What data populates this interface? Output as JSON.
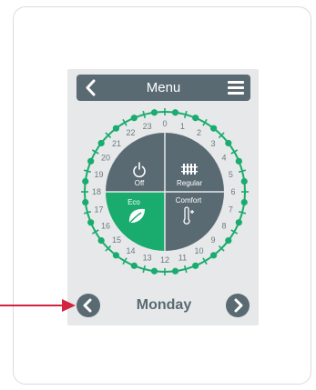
{
  "colors": {
    "accent_green": "#1aab6e",
    "panel_gray": "#5a6a72",
    "device_bg": "#e6e8e9",
    "arrow_red": "#d2243e"
  },
  "header": {
    "title": "Menu",
    "back_icon": "chevron-left-icon",
    "menu_icon": "hamburger-icon"
  },
  "dial": {
    "hours": [
      "0",
      "1",
      "2",
      "3",
      "4",
      "5",
      "6",
      "7",
      "8",
      "9",
      "10",
      "11",
      "12",
      "13",
      "14",
      "15",
      "16",
      "17",
      "18",
      "19",
      "20",
      "21",
      "22",
      "23"
    ],
    "modes": [
      {
        "label": "Off",
        "icon": "power-icon",
        "active": false
      },
      {
        "label": "Regular",
        "icon": "radiator-icon",
        "active": false
      },
      {
        "label": "Eco",
        "icon": "leaf-icon",
        "active": true
      },
      {
        "label": "Comfort",
        "icon": "thermometer-plus-icon",
        "active": false
      }
    ]
  },
  "footer": {
    "day": "Monday",
    "prev_icon": "chevron-left-icon",
    "next_icon": "chevron-right-icon"
  },
  "annotation": {
    "icon": "arrow-right-icon"
  }
}
